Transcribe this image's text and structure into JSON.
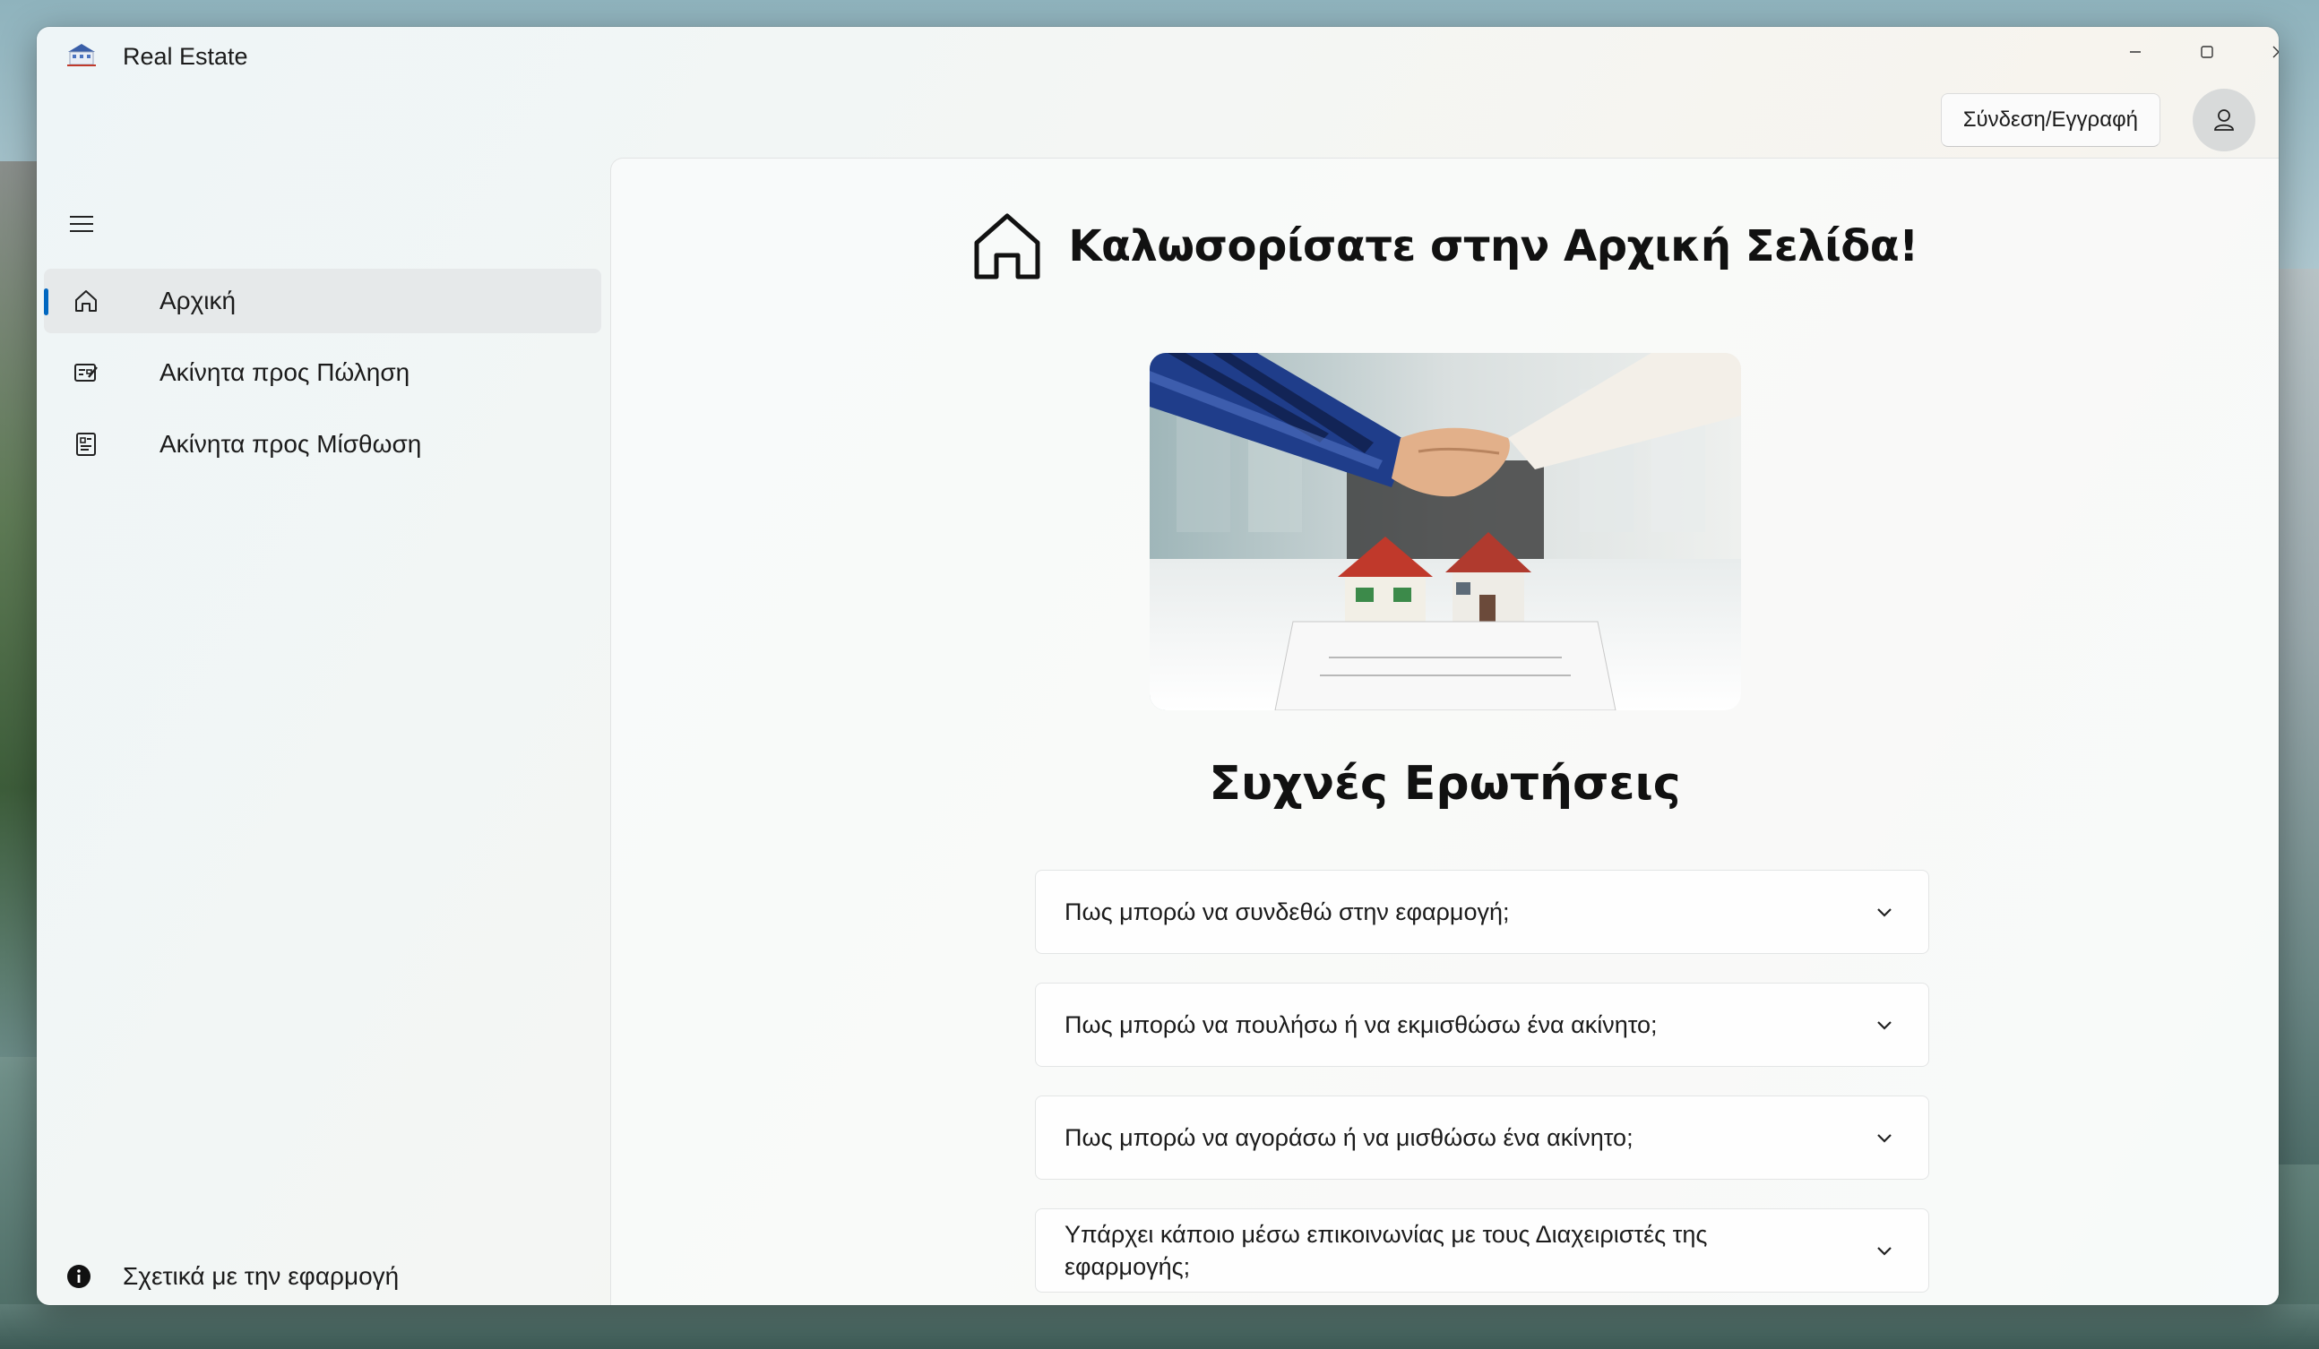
{
  "window": {
    "title": "Real Estate"
  },
  "header": {
    "login_label": "Σύνδεση/Εγγραφή"
  },
  "sidebar": {
    "items": [
      {
        "label": "Αρχική",
        "icon": "home-icon",
        "selected": true
      },
      {
        "label": "Ακίνητα προς Πώληση",
        "icon": "sale-listing-icon",
        "selected": false
      },
      {
        "label": "Ακίνητα προς Μίσθωση",
        "icon": "rent-listing-icon",
        "selected": false
      }
    ],
    "about_label": "Σχετικά με την εφαρμογή"
  },
  "main": {
    "welcome_title": "Καλωσορίσατε στην Αρχική Σελίδα!",
    "faq_title": "Συχνές Ερωτήσεις",
    "faq": [
      {
        "question": "Πως μπορώ να συνδεθώ στην εφαρμογή;"
      },
      {
        "question": "Πως μπορώ να πουλήσω ή να εκμισθώσω ένα ακίνητο;"
      },
      {
        "question": "Πως μπορώ να αγοράσω ή να μισθώσω ένα ακίνητο;"
      },
      {
        "question": "Υπάρχει κάποιο μέσω επικοινωνίας με τους Διαχειριστές της εφαρμογής;"
      }
    ]
  },
  "colors": {
    "accent": "#0067c0",
    "selected_bg": "#e6e9ea"
  }
}
